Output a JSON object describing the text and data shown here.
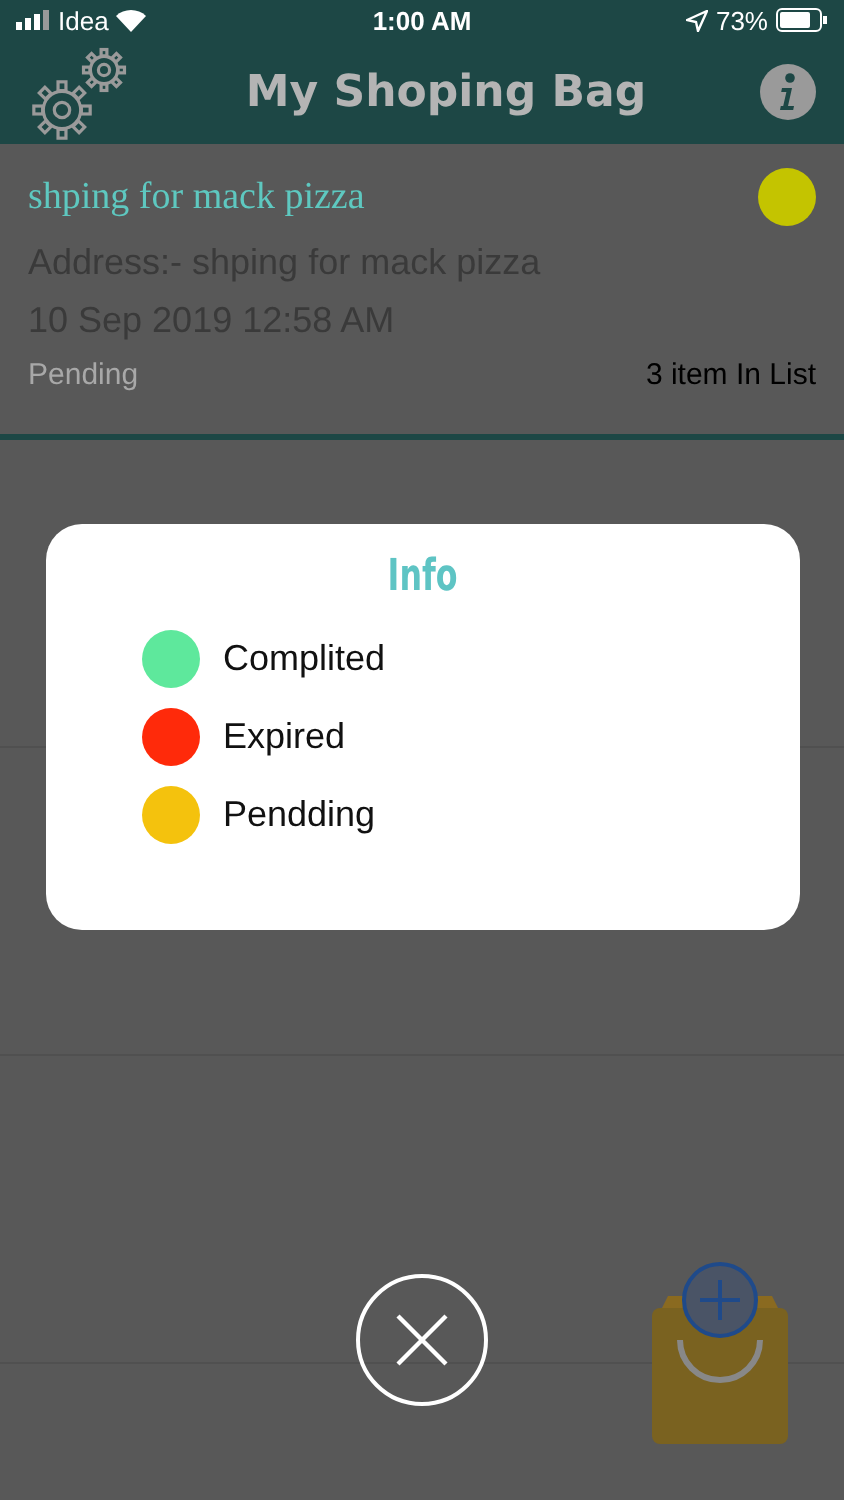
{
  "status_bar": {
    "carrier": "Idea",
    "time": "1:00 AM",
    "battery": "73%"
  },
  "header": {
    "title": "My Shoping Bag"
  },
  "lists": [
    {
      "title": "shping for mack pizza",
      "address": "Address:- shping for mack pizza",
      "date": "10 Sep 2019 12:58 AM",
      "status": "Pending",
      "count": "3 item In List",
      "color": "#c4c400"
    }
  ],
  "dialog": {
    "title": "Info",
    "legend": [
      {
        "label": "Complited",
        "color": "#5ee89c"
      },
      {
        "label": "Expired",
        "color": "#ff2a0a"
      },
      {
        "label": "Pendding",
        "color": "#f4c20d"
      }
    ]
  }
}
